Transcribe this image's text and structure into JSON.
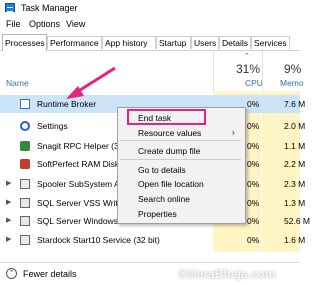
{
  "window": {
    "title": "Task Manager"
  },
  "menubar": [
    "File",
    "Options",
    "View"
  ],
  "tabs": [
    "Processes",
    "Performance",
    "App history",
    "Startup",
    "Users",
    "Details",
    "Services"
  ],
  "columns": {
    "name": "Name",
    "cpu_percent": "31%",
    "cpu_label": "CPU",
    "memory_percent": "9%",
    "memory_label": "Memo"
  },
  "processes": [
    {
      "name": "Runtime Broker",
      "cpu": "0%",
      "memory": "7.6 M"
    },
    {
      "name": "Settings",
      "cpu": "0%",
      "memory": "2.0 M"
    },
    {
      "name": "Snagit RPC Helper (3",
      "cpu": "0%",
      "memory": "1.1 M"
    },
    {
      "name": "SoftPerfect RAM Disk",
      "cpu": "0%",
      "memory": "2.2 M"
    },
    {
      "name": "Spooler SubSystem A",
      "cpu": "0%",
      "memory": "2.3 M"
    },
    {
      "name": "SQL Server VSS Write",
      "cpu": "0%",
      "memory": "1.3 M"
    },
    {
      "name": "SQL Server Windows NT - 64 Bit",
      "cpu": "0%",
      "memory": "52.6 M"
    },
    {
      "name": "Stardock Start10 Service (32 bit)",
      "cpu": "0%",
      "memory": "1.6 M"
    }
  ],
  "context_menu": [
    "End task",
    "Resource values",
    "Create dump file",
    "Go to details",
    "Open file location",
    "Search online",
    "Properties"
  ],
  "footer": {
    "label": "Fewer details"
  },
  "watermark": "©MeraBheja.com",
  "colors": {
    "highlight": "#e6237f",
    "selection": "#cce4f7",
    "cpu_column": "#fff4c4"
  }
}
